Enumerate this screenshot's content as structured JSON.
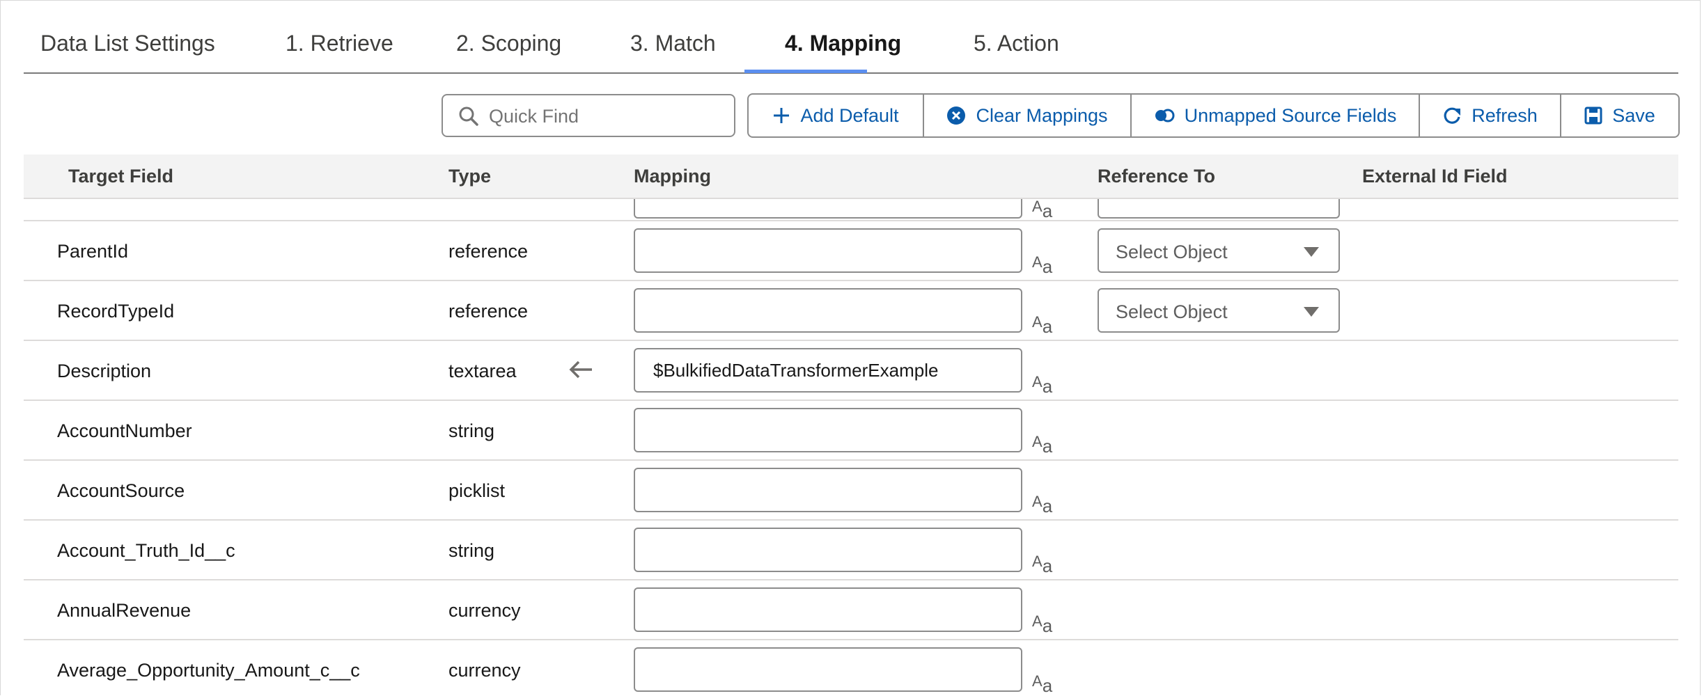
{
  "tabs": [
    {
      "label": "Data List Settings"
    },
    {
      "label": "1. Retrieve"
    },
    {
      "label": "2. Scoping"
    },
    {
      "label": "3. Match"
    },
    {
      "label": "4. Mapping",
      "active": true
    },
    {
      "label": "5. Action"
    }
  ],
  "toolbar": {
    "search_placeholder": "Quick Find",
    "add_default": "Add Default",
    "clear_mappings": "Clear Mappings",
    "unmapped_source_fields": "Unmapped Source Fields",
    "refresh": "Refresh",
    "save": "Save"
  },
  "table": {
    "headers": {
      "target_field": "Target Field",
      "type": "Type",
      "mapping": "Mapping",
      "reference_to": "Reference To",
      "external_id_field": "External Id Field"
    },
    "aa_large": "A",
    "aa_small": "a",
    "rows": [
      {
        "name": "ParentId",
        "type": "reference",
        "mapping": "",
        "reference": "Select Object"
      },
      {
        "name": "RecordTypeId",
        "type": "reference",
        "mapping": "",
        "reference": "Select Object"
      },
      {
        "name": "Description",
        "type": "textarea",
        "mapping": "$BulkifiedDataTransformerExample",
        "has_arrow": true
      },
      {
        "name": "AccountNumber",
        "type": "string",
        "mapping": ""
      },
      {
        "name": "AccountSource",
        "type": "picklist",
        "mapping": ""
      },
      {
        "name": "Account_Truth_Id__c",
        "type": "string",
        "mapping": ""
      },
      {
        "name": "AnnualRevenue",
        "type": "currency",
        "mapping": ""
      },
      {
        "name": "Average_Opportunity_Amount_c__c",
        "type": "currency",
        "mapping": ""
      }
    ]
  },
  "colors": {
    "accent": "#5b8ff0",
    "button_text": "#0b5cab",
    "header_bg": "#f3f3f3"
  }
}
